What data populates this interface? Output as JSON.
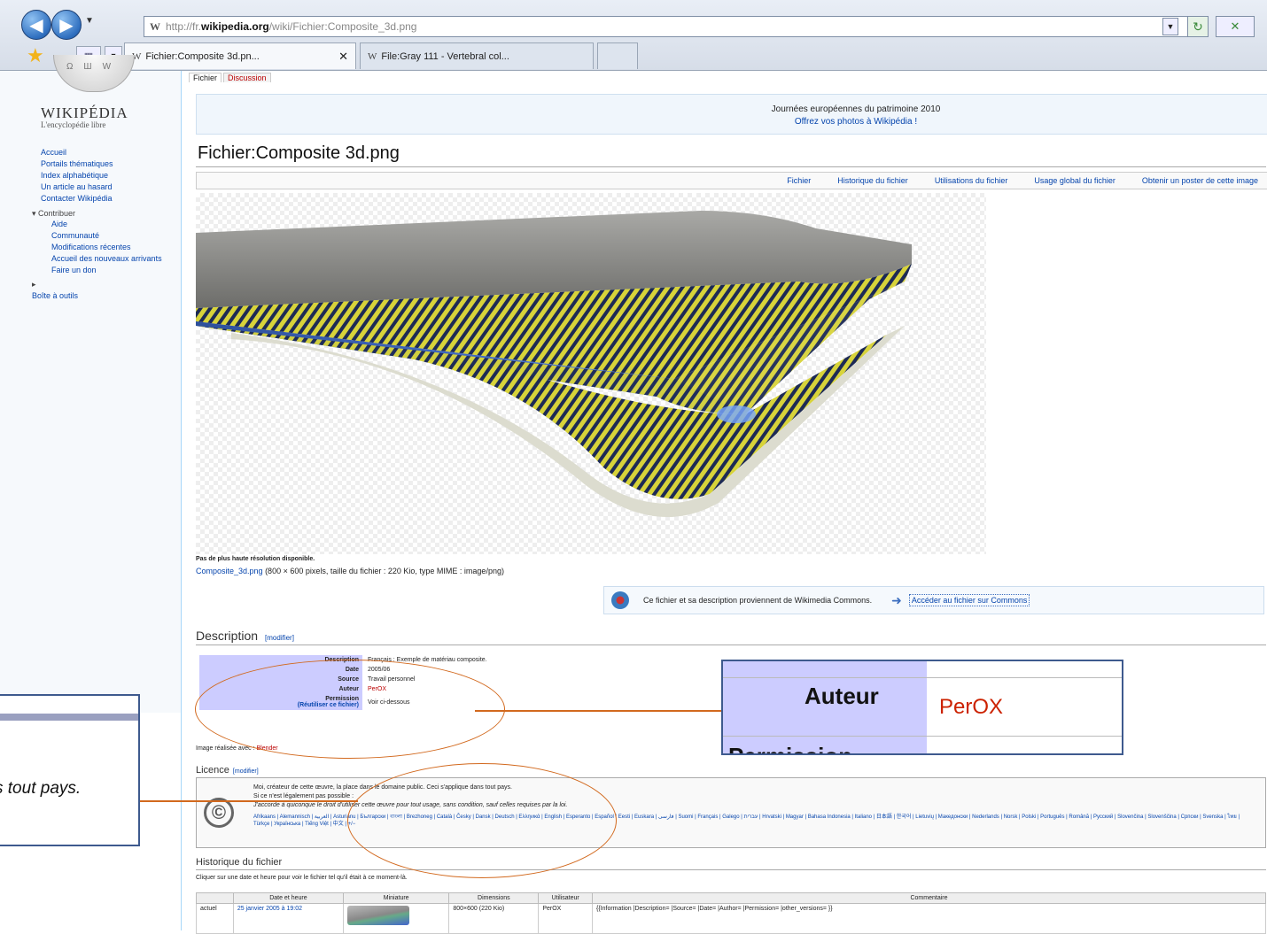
{
  "browser": {
    "url_prefix": "http://fr.",
    "url_host": "wikipedia.org",
    "url_path": "/wiki/Fichier:Composite_3d.png",
    "tabs": [
      {
        "label": "Fichier:Composite 3d.pn...",
        "active": true
      },
      {
        "label": "File:Gray 111 - Vertebral col...",
        "active": false
      }
    ]
  },
  "sidebar": {
    "logo": "WIKIPÉDIA",
    "tagline": "L'encyclopédie libre",
    "nav": [
      "Accueil",
      "Portails thématiques",
      "Index alphabétique",
      "Un article au hasard",
      "Contacter Wikipédia"
    ],
    "contrib_header": "Contribuer",
    "contrib": [
      "Aide",
      "Communauté",
      "Modifications récentes",
      "Accueil des nouveaux arrivants",
      "Faire un don"
    ],
    "toolbox": "Boîte à outils"
  },
  "content": {
    "ns_tabs": [
      "Fichier",
      "Discussion"
    ],
    "banner_line1": "Journées européennes du patrimoine 2010",
    "banner_line2": "Offrez vos photos à Wikipédia !",
    "title": "Fichier:Composite 3d.png",
    "file_menu": [
      "Fichier",
      "Historique du fichier",
      "Utilisations du fichier",
      "Usage global du fichier",
      "Obtenir un poster de cette image"
    ],
    "no_hi_res": "Pas de plus haute résolution disponible.",
    "file_link": "Composite_3d.png",
    "file_meta": " (800 × 600 pixels, taille du fichier : 220 Kio, type MIME : image/png)",
    "commons_note": "Ce fichier et sa description proviennent de Wikimedia Commons.",
    "commons_link": "Accéder au fichier sur Commons",
    "desc_heading": "Description",
    "edit_label": "[modifier]",
    "desc_rows": [
      {
        "label": "Description",
        "value": "Français : Exemple de matériau composite."
      },
      {
        "label": "Date",
        "value": "2005/06"
      },
      {
        "label": "Source",
        "value": "Travail personnel"
      },
      {
        "label": "Auteur",
        "value": "PerOX"
      },
      {
        "label": "Permission",
        "value": "Voir ci-dessous"
      }
    ],
    "permission_sub": "(Réutiliser ce fichier)",
    "image_note_prefix": "Image réalisée avec : ",
    "image_note_tool": "Blender",
    "licence_heading": "Licence",
    "licence_line1": "Moi, créateur de cette œuvre, la place dans le domaine public. Ceci s'applique dans tout pays.",
    "licence_line2": "Si ce n'est légalement pas possible :",
    "licence_line3": "J'accorde à quiconque le droit d'utiliser cette œuvre pour tout usage, sans condition, sauf celles requises par la loi.",
    "licence_langs": "Afrikaans | Alemannisch | العربية | Asturianu | Български | বাংলা | Brezhoneg | Català | Česky | Dansk | Deutsch | Ελληνικά | English | Esperanto | Español | Eesti | Euskara | فارسی | Suomi | Français | Galego | עברית | Hrvatski | Magyar | Bahasa Indonesia | Italiano | 日本語 | 한국어 | Lietuvių | Македонски | Nederlands | Norsk | Polski | Português | Română | Русский | Slovenčina | Slovenščina | Српски | Svenska | ไทย | Türkçe | Українська | Tiếng Việt | 中文 | +/−",
    "history_heading": "Historique du fichier",
    "history_hint": "Cliquer sur une date et heure pour voir le fichier tel qu'il était à ce moment-là.",
    "history_cols": [
      "",
      "Date et heure",
      "Miniature",
      "Dimensions",
      "Utilisateur",
      "Commentaire"
    ],
    "history_row": {
      "state": "actuel",
      "date": "25 janvier 2005 à 19:02",
      "dims": "800×600 (220 Kio)",
      "user": "PerOX",
      "comment": "{{Information |Description= |Source= |Date= |Author= |Permission= |other_versions= }}"
    }
  },
  "annotations": {
    "zoom_label": "Auteur",
    "zoom_value": "PerOX",
    "zoom_cut": "Permission",
    "zoom_licence_text": "s tout pays."
  },
  "colors": {
    "link": "#0645ad",
    "red_link": "#ba0000",
    "annotation": "#d2691e",
    "zoom_border": "#3e5a8e",
    "table_header": "#ccccff"
  }
}
